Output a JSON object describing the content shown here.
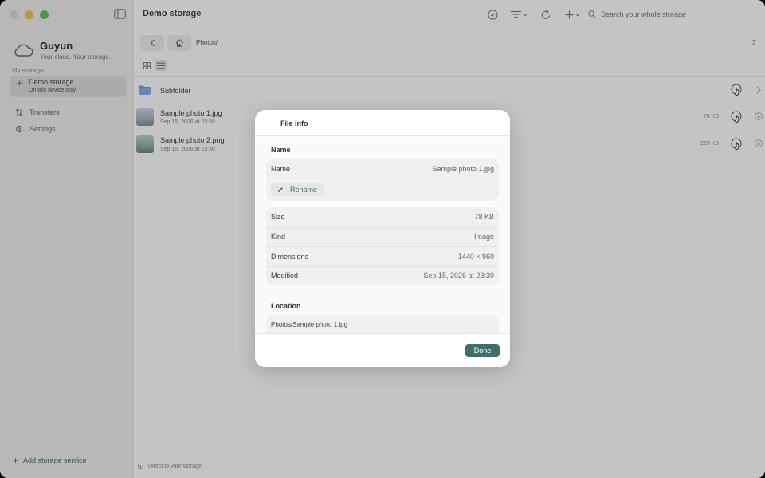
{
  "app": {
    "name": "Guyun",
    "tagline": "Your cloud. Your storage."
  },
  "sidebar": {
    "section_label": "My storage",
    "storage": {
      "name": "Demo storage",
      "sub": "On this device only"
    },
    "nav": [
      {
        "label": "Transfers",
        "icon": "transfers-icon"
      },
      {
        "label": "Settings",
        "icon": "gear-icon"
      }
    ],
    "add_storage": "Add storage service"
  },
  "toolbar": {
    "title": "Demo storage",
    "search_placeholder": "Search your whole storage"
  },
  "pathbar": {
    "path": "Photos/",
    "count": "3"
  },
  "files": [
    {
      "name": "Subfolder",
      "type": "folder"
    },
    {
      "name": "Sample photo 1.jpg",
      "date": "Sep 15, 2026 at 23:30",
      "size": "78 KB"
    },
    {
      "name": "Sample photo 2.png",
      "date": "Sep 15, 2026 at 23:30",
      "size": "229 KB"
    }
  ],
  "footer": {
    "text": "Direct to your storage"
  },
  "modal": {
    "title": "File info",
    "name_section": "Name",
    "name_label": "Name",
    "name_value": "Sample photo 1.jpg",
    "rename_label": "Rename",
    "details": [
      {
        "k": "Size",
        "v": "78 KB"
      },
      {
        "k": "Kind",
        "v": "Image"
      },
      {
        "k": "Dimensions",
        "v": "1440 × 960"
      },
      {
        "k": "Modified",
        "v": "Sep 15, 2026 at 23:30"
      }
    ],
    "location_section": "Location",
    "location_value": "Photos/Sample photo 1.jpg",
    "done_label": "Done"
  },
  "colors": {
    "accent": "#3f6f69",
    "folder": "#6f9bd8"
  }
}
